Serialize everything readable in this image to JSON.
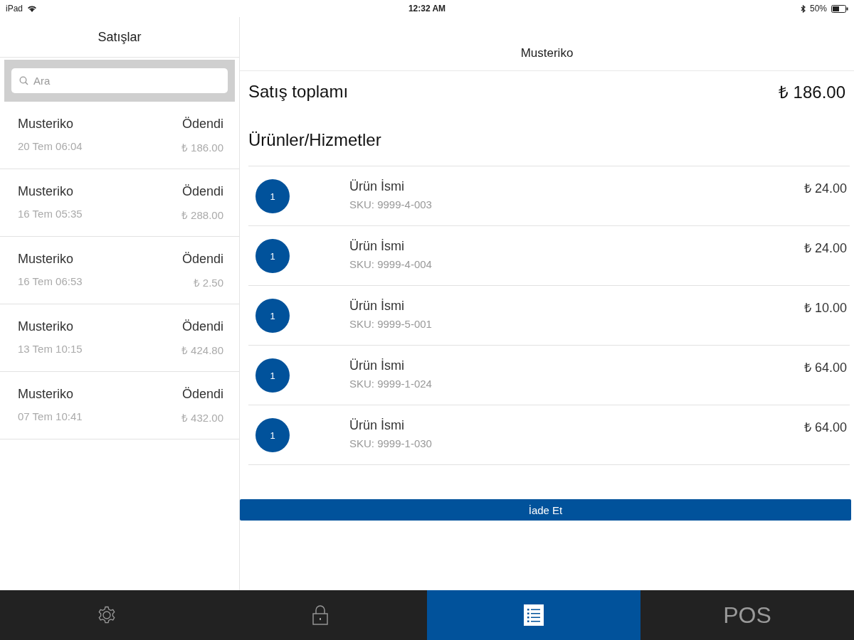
{
  "status_bar": {
    "device": "iPad",
    "time": "12:32 AM",
    "battery": "50%"
  },
  "sidebar": {
    "title": "Satışlar",
    "search": {
      "placeholder": "Ara"
    },
    "sales": [
      {
        "customer": "Musteriko",
        "status": "Ödendi",
        "date": "20 Tem 06:04",
        "amount": "₺ 186.00"
      },
      {
        "customer": "Musteriko",
        "status": "Ödendi",
        "date": "16 Tem 05:35",
        "amount": "₺ 288.00"
      },
      {
        "customer": "Musteriko",
        "status": "Ödendi",
        "date": "16 Tem 06:53",
        "amount": "₺ 2.50"
      },
      {
        "customer": "Musteriko",
        "status": "Ödendi",
        "date": "13 Tem 10:15",
        "amount": "₺ 424.80"
      },
      {
        "customer": "Musteriko",
        "status": "Ödendi",
        "date": "07 Tem 10:41",
        "amount": "₺ 432.00"
      }
    ]
  },
  "detail": {
    "title": "Musteriko",
    "total_label": "Satış toplamı",
    "total": "₺ 186.00",
    "section_title": "Ürünler/Hizmetler",
    "items": [
      {
        "quantity": "1",
        "name": "Ürün İsmi",
        "sku": "SKU: 9999-4-003",
        "price": "₺ 24.00"
      },
      {
        "quantity": "1",
        "name": "Ürün İsmi",
        "sku": "SKU: 9999-4-004",
        "price": "₺ 24.00"
      },
      {
        "quantity": "1",
        "name": "Ürün İsmi",
        "sku": "SKU: 9999-5-001",
        "price": "₺ 10.00"
      },
      {
        "quantity": "1",
        "name": "Ürün İsmi",
        "sku": "SKU: 9999-1-024",
        "price": "₺ 64.00"
      },
      {
        "quantity": "1",
        "name": "Ürün İsmi",
        "sku": "SKU: 9999-1-030",
        "price": "₺ 64.00"
      }
    ],
    "refund_button": "İade Et"
  },
  "tab_bar": [
    {
      "kind": "settings",
      "selected": false
    },
    {
      "kind": "lock",
      "selected": false
    },
    {
      "kind": "list",
      "selected": true
    },
    {
      "kind": "text",
      "label": "POS",
      "selected": false
    }
  ]
}
